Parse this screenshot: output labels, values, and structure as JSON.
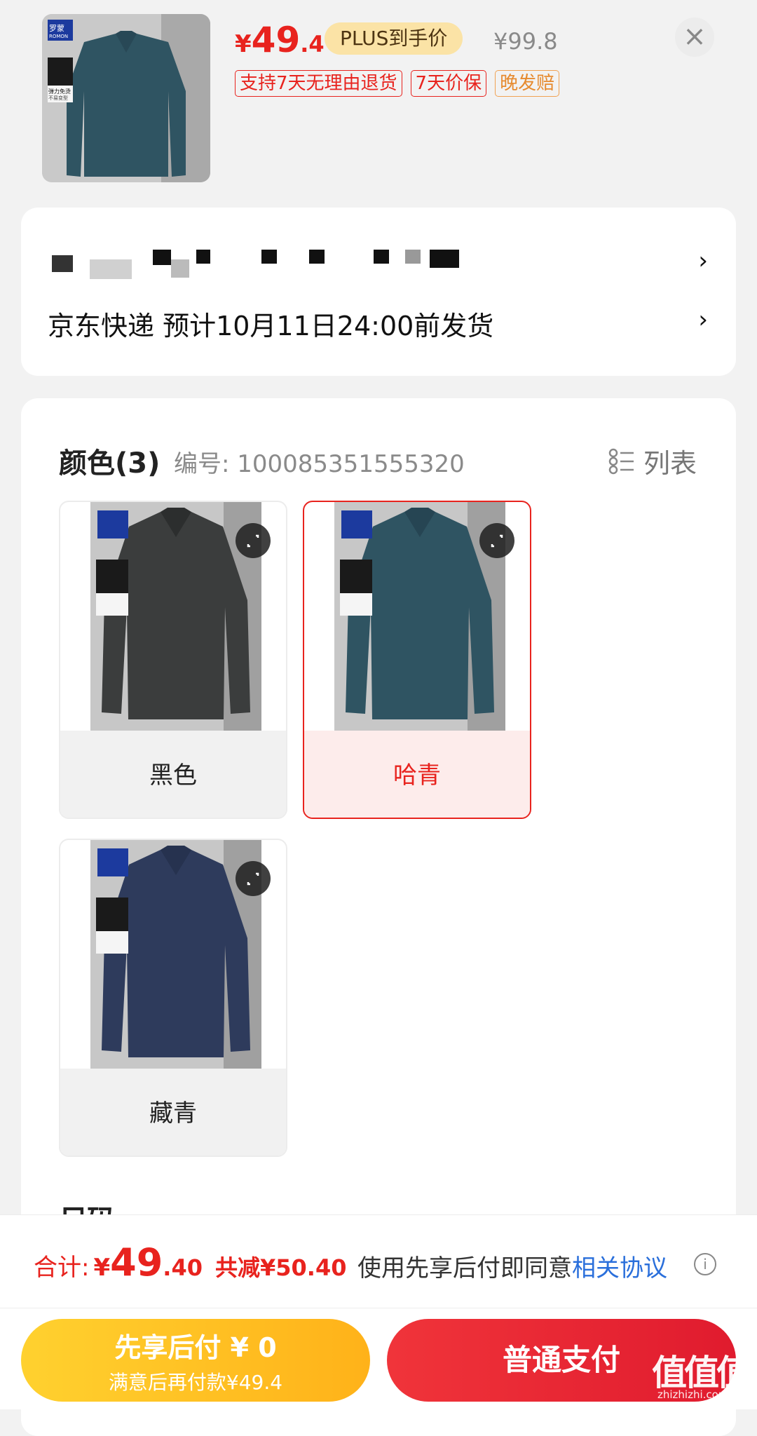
{
  "header": {
    "price_currency": "¥",
    "price_int": "49",
    "price_dec": ".4",
    "plus_badge": "PLUS到手价",
    "original_price": "¥99.8",
    "close_icon": "×",
    "tags": [
      "支持7天无理由退货",
      "7天价保",
      "晚发赔"
    ],
    "thumb_brand": "罗蒙",
    "thumb_brand_en": "ROMON",
    "thumb_feature_1": "弹力免烫",
    "thumb_feature_2": "不易变型"
  },
  "address": {
    "shipping": "京东快递 预计10月11日24:00前发货",
    "chevron": "›"
  },
  "spec": {
    "color_title": "颜色(3)",
    "sku": "编号: 100085351555320",
    "list_label": "列表",
    "options": [
      {
        "label": "黑色",
        "color": "#3b3d3d"
      },
      {
        "label": "哈青",
        "color": "#2f5462"
      },
      {
        "label": "藏青",
        "color": "#2e3b5c"
      }
    ],
    "next_section_title": "尺码"
  },
  "bottom": {
    "total_label": "合计:",
    "total_currency": "¥",
    "total_int": "49",
    "total_dec": ".40",
    "saved": "共减¥50.40",
    "agree_text": "使用先享后付即同意",
    "agree_link": "相关协议",
    "info_icon": "i",
    "pay_later_line1": "先享后付 ¥ 0",
    "pay_later_line2": "满意后再付款¥49.4",
    "pay_normal": "普通支付"
  },
  "watermark": {
    "main": "值值值",
    "sub": "zhizhizhi.com"
  },
  "colors": {
    "accent_red": "#e8231e",
    "plus_gold": "#fbe3a6",
    "pay_later_yellow": "#ffc21f",
    "link_blue": "#2a6fdb"
  }
}
